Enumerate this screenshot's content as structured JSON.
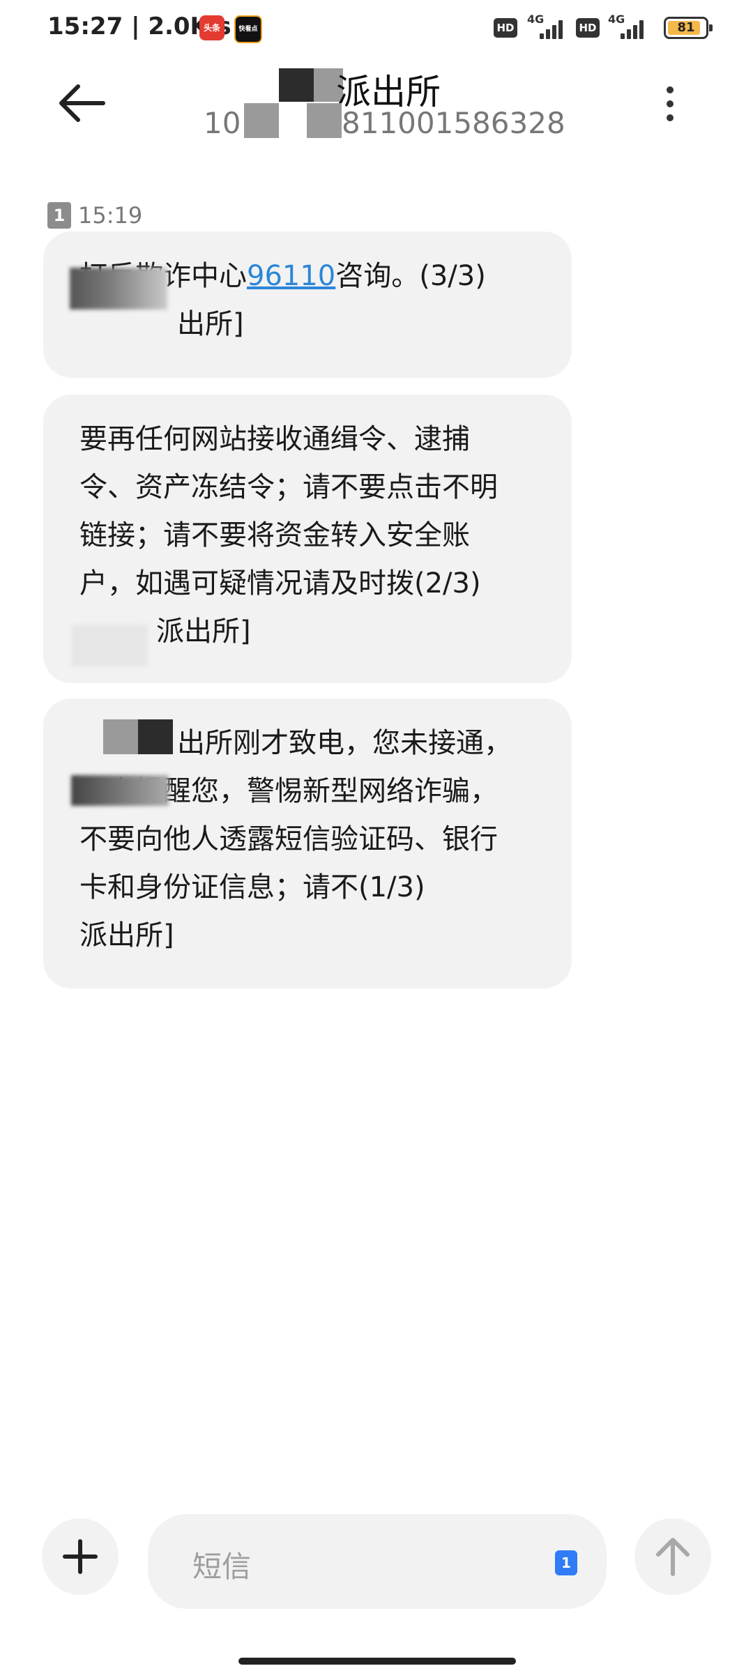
{
  "status_bar": {
    "time_speed": "15:27 | 2.0K/s",
    "app_badge_1": "头条",
    "app_badge_2": "快看点",
    "hd_1": "HD",
    "net_1": "4G",
    "hd_2": "HD",
    "net_2": "4G",
    "battery_level": "81"
  },
  "header": {
    "title": "派出所",
    "number_prefix": "10",
    "number_suffix": "811001586328"
  },
  "thread": {
    "sim_badge": "1",
    "timestamp": "15:19",
    "messages": [
      {
        "lines": [
          {
            "pre": "打反欺诈中心",
            "link": "96110",
            "post": "咨询。(3/3)"
          },
          {
            "text": "出所]"
          }
        ]
      },
      {
        "lines": [
          {
            "text": "要再任何网站接收通缉令、逮捕"
          },
          {
            "text": "令、资产冻结令；请不要点击不明"
          },
          {
            "text": "链接；请不要将资金转入安全账"
          },
          {
            "text": "户，如遇可疑情况请及时拨(2/3)"
          },
          {
            "text": "派出所]"
          }
        ]
      },
      {
        "lines": [
          {
            "text": "出所刚才致电，您未接通，"
          },
          {
            "text": "再次提醒您，警惕新型网络诈骗，"
          },
          {
            "text": "不要向他人透露短信验证码、银行"
          },
          {
            "text": "卡和身份证信息；请不(1/3)"
          },
          {
            "text": "派出所]"
          }
        ]
      }
    ]
  },
  "composer": {
    "placeholder": "短信",
    "sim_pick": "1"
  },
  "colors": {
    "bubble_bg": "#f2f2f2",
    "link": "#2b86d9",
    "sim_picker": "#2f7cf6"
  }
}
